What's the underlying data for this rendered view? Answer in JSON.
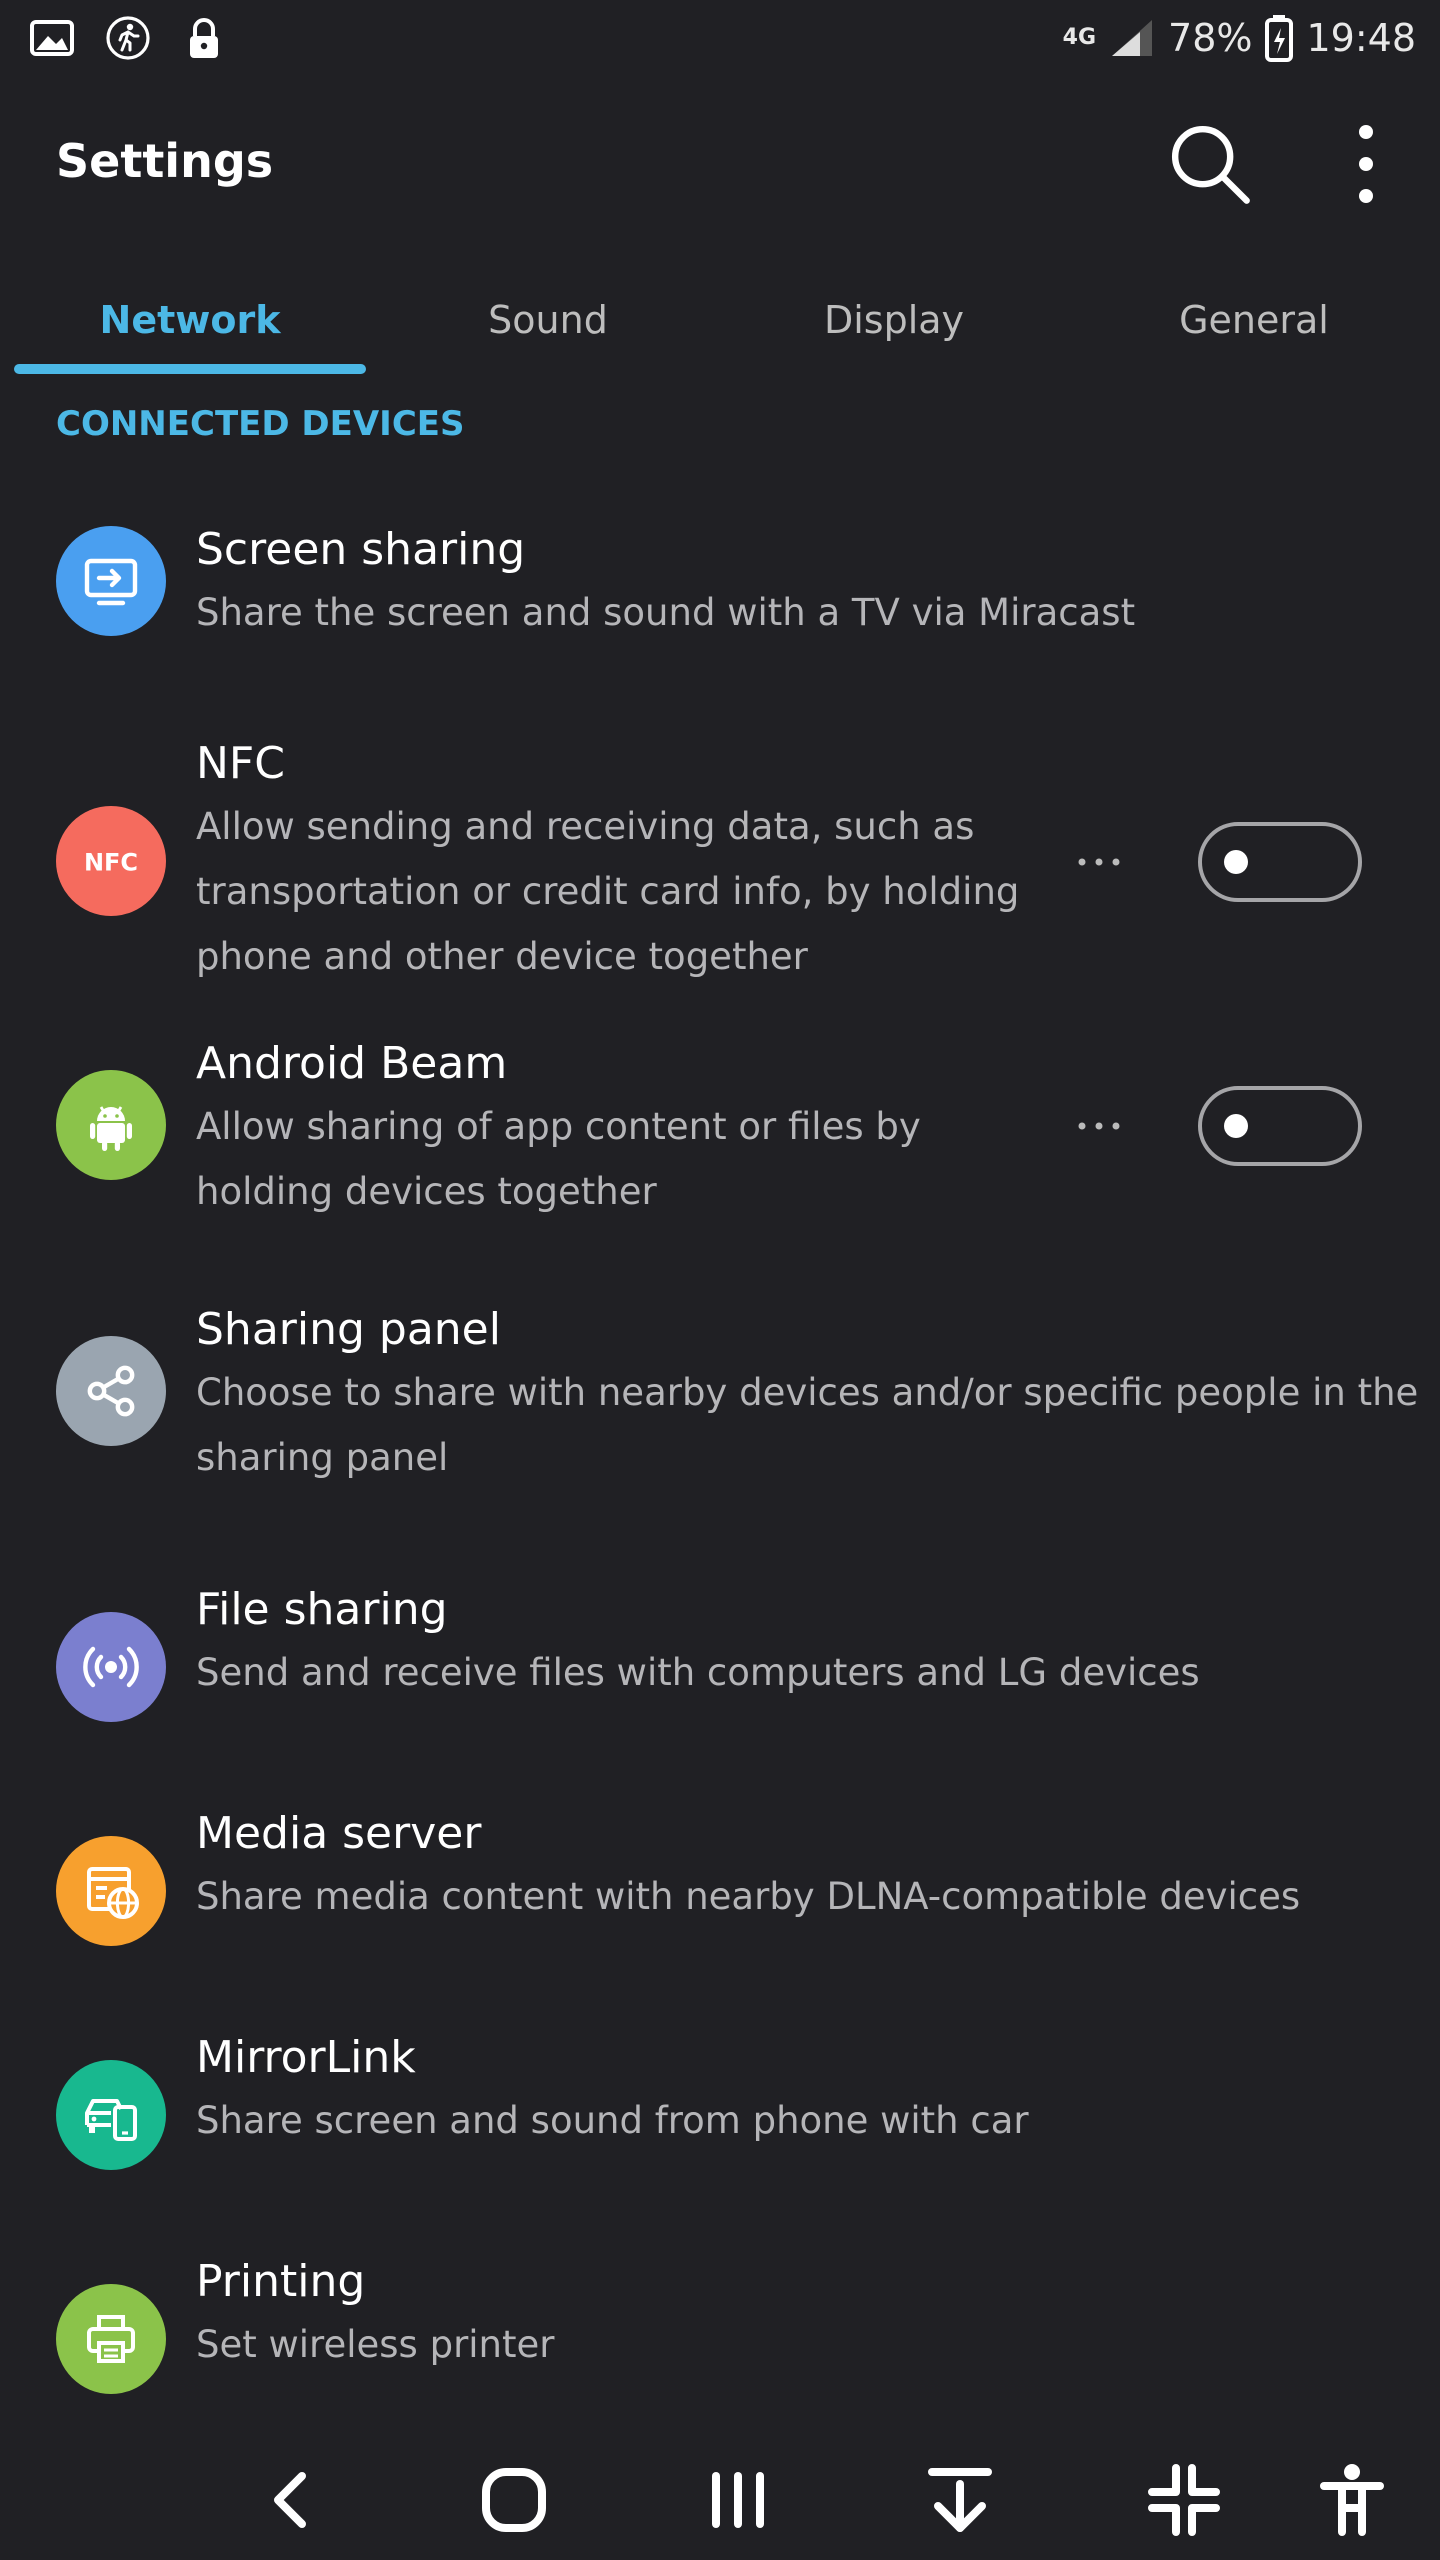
{
  "status_bar": {
    "left_icons": [
      "gallery-icon",
      "running-person-icon",
      "lock-icon"
    ],
    "network": "4G",
    "battery": "78%",
    "time": "19:48"
  },
  "app_bar": {
    "title": "Settings",
    "actions": [
      "search-icon",
      "more-vert-icon"
    ]
  },
  "tabs": [
    {
      "label": "Network",
      "active": true
    },
    {
      "label": "Sound",
      "active": false
    },
    {
      "label": "Display",
      "active": false
    },
    {
      "label": "General",
      "active": false
    }
  ],
  "section_header": "CONNECTED DEVICES",
  "items": [
    {
      "title": "Screen sharing",
      "subtitle": "Share the screen and sound with a TV via Miracast",
      "icon": "screen-share-icon",
      "color": "#4a9ff0"
    },
    {
      "title": "NFC",
      "subtitle_lines": [
        "Allow sending and receiving data, such as",
        "transportation or credit card info, by holding",
        "phone and other device together"
      ],
      "icon": "nfc-icon",
      "color": "#f56b5e",
      "toggle": false
    },
    {
      "title": "Android Beam",
      "subtitle_lines": [
        "Allow sharing of app content or files by",
        "holding devices together"
      ],
      "icon": "android-icon",
      "color": "#8bc34a",
      "toggle": false
    },
    {
      "title": "Sharing panel",
      "subtitle_lines": [
        "Choose to share with nearby devices and/or specific people in the",
        "sharing panel"
      ],
      "icon": "share-icon",
      "color": "#9aa5b0"
    },
    {
      "title": "File sharing",
      "subtitle": "Send and receive files with computers and LG devices",
      "icon": "broadcast-icon",
      "color": "#7b7fcf"
    },
    {
      "title": "Media server",
      "subtitle": "Share media content with nearby DLNA-compatible devices",
      "icon": "media-server-icon",
      "color": "#f7a02e"
    },
    {
      "title": "MirrorLink",
      "subtitle": "Share screen and sound from phone with car",
      "icon": "car-phone-icon",
      "color": "#18b88f"
    },
    {
      "title": "Printing",
      "subtitle": "Set wireless printer",
      "icon": "printer-icon",
      "color": "#8bc34a"
    }
  ],
  "nav_bar": [
    "back-icon",
    "home-icon",
    "recents-icon",
    "notification-pull-icon",
    "collapse-icon",
    "accessibility-icon"
  ],
  "colors": {
    "background": "#202024",
    "accent": "#4cb8e6"
  }
}
